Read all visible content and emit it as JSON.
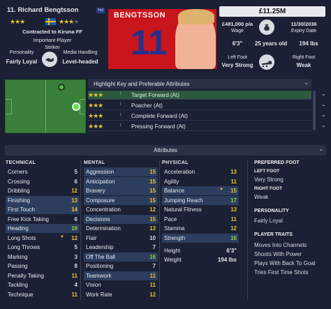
{
  "player": {
    "name": "11. Richard Bengtsson",
    "badge": "Hol",
    "contract": "Contracted to Kiruna FF",
    "status": "Important Player",
    "position": "Striker",
    "personality_label": "Personality",
    "personality": "Fairly Loyal",
    "media_label": "Media Handling",
    "media": "Level-headed",
    "current_ability_stars": "★★★",
    "potential_ability_stars": "★★★",
    "potential_dim_star": "★",
    "shirt_name": "BENGTSSON",
    "shirt_number": "11"
  },
  "info": {
    "value": "£11.25M",
    "wage": "£481,000 p/a",
    "wage_label": "Wage",
    "expiry": "11/30/2036",
    "expiry_label": "Expiry Date",
    "height": "6'3\"",
    "age": "25 years old",
    "weight": "194 lbs",
    "left_foot_label": "Left Foot",
    "left_foot": "Very Strong",
    "right_foot_label": "Right Foot",
    "right_foot": "Weak"
  },
  "roles": {
    "header": "Highlight Key and Preferable Attributes",
    "items": [
      {
        "label": "Target Forward (At)",
        "stars": "★★★",
        "info": "i"
      },
      {
        "label": "Poacher (At)",
        "stars": "★★★",
        "info": "i"
      },
      {
        "label": "Complete Forward (At)",
        "stars": "★★★",
        "info": "i"
      },
      {
        "label": "Pressing Forward (At)",
        "stars": "★★★",
        "info": "i"
      }
    ]
  },
  "attributes": {
    "header": "Attributes",
    "technical_title": "TECHNICAL",
    "mental_title": "MENTAL",
    "physical_title": "PHYSICAL",
    "technical": [
      {
        "name": "Corners",
        "value": "5"
      },
      {
        "name": "Crossing",
        "value": "6"
      },
      {
        "name": "Dribbling",
        "value": "12"
      },
      {
        "name": "Finishing",
        "value": "13"
      },
      {
        "name": "First Touch",
        "value": "14"
      },
      {
        "name": "Free Kick Taking",
        "value": "6"
      },
      {
        "name": "Heading",
        "value": "16"
      },
      {
        "name": "Long Shots",
        "value": "12"
      },
      {
        "name": "Long Throws",
        "value": "5"
      },
      {
        "name": "Marking",
        "value": "3"
      },
      {
        "name": "Passing",
        "value": "8"
      },
      {
        "name": "Penalty Taking",
        "value": "11"
      },
      {
        "name": "Tackling",
        "value": "4"
      },
      {
        "name": "Technique",
        "value": "11"
      }
    ],
    "mental": [
      {
        "name": "Aggression",
        "value": "15"
      },
      {
        "name": "Anticipation",
        "value": "15"
      },
      {
        "name": "Bravery",
        "value": "15"
      },
      {
        "name": "Composure",
        "value": "15"
      },
      {
        "name": "Concentration",
        "value": "12"
      },
      {
        "name": "Decisions",
        "value": "15"
      },
      {
        "name": "Determination",
        "value": "13"
      },
      {
        "name": "Flair",
        "value": "10"
      },
      {
        "name": "Leadership",
        "value": "7"
      },
      {
        "name": "Off The Ball",
        "value": "16"
      },
      {
        "name": "Positioning",
        "value": "7"
      },
      {
        "name": "Teamwork",
        "value": "11"
      },
      {
        "name": "Vision",
        "value": "11"
      },
      {
        "name": "Work Rate",
        "value": "12"
      }
    ],
    "physical": [
      {
        "name": "Acceleration",
        "value": "13"
      },
      {
        "name": "Agility",
        "value": "11"
      },
      {
        "name": "Balance",
        "value": "15"
      },
      {
        "name": "Jumping Reach",
        "value": "17"
      },
      {
        "name": "Natural Fitness",
        "value": "13"
      },
      {
        "name": "Pace",
        "value": "11"
      },
      {
        "name": "Stamina",
        "value": "12"
      },
      {
        "name": "Strength",
        "value": "16"
      }
    ],
    "height_label": "Height",
    "height": "6'3\"",
    "weight_label": "Weight",
    "weight": "194 lbs"
  },
  "sidebar": {
    "preferred_foot_title": "PREFERRED FOOT",
    "left_foot_title": "LEFT FOOT",
    "left_foot": "Very Strong",
    "right_foot_title": "RIGHT FOOT",
    "right_foot": "Weak",
    "personality_title": "PERSONALITY",
    "personality": "Fairly Loyal",
    "traits_title": "PLAYER TRAITS",
    "traits": [
      "Moves Into Channels",
      "Shoots With Power",
      "Plays With Back To Goal",
      "Tries First Time Shots"
    ]
  },
  "colors": {
    "background": "#1b2034",
    "highlight": "#2c3d5e",
    "selected_role": "#2d5a3e",
    "star": "#e8c430",
    "shirt": "#c9151c"
  }
}
